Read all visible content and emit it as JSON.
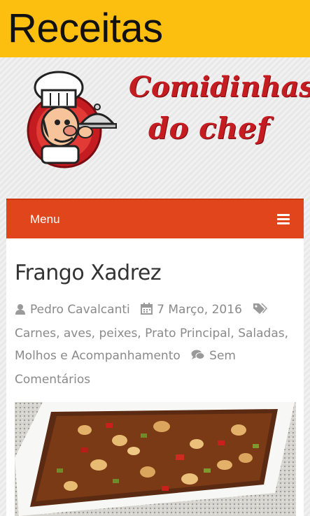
{
  "app": {
    "title": "Receitas"
  },
  "site": {
    "logo_line1": "Comidinhas",
    "logo_line2": "do chef"
  },
  "nav": {
    "menu_label": "Menu",
    "menu_icon": "hamburger-icon"
  },
  "post": {
    "title": "Frango Xadrez",
    "author": "Pedro Cavalcanti",
    "date": "7 Março, 2016",
    "categories": "Carnes, aves, peixes, Prato Principal, Saladas, Molhos e Acompanhamento",
    "comments": "Sem Comentários"
  },
  "colors": {
    "header": "#fdbf0f",
    "menu_bar": "#e0451b",
    "logo_red": "#c51c22"
  }
}
